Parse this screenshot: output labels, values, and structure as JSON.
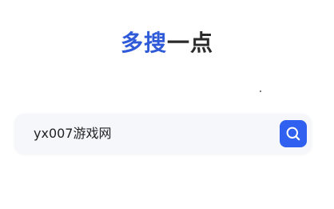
{
  "brand": {
    "part1": "多搜",
    "part2": "一点",
    "part1_color": "#2f5ad8",
    "part2_color": "#2a2a2a"
  },
  "search": {
    "value": "yx007游戏网",
    "button_icon": "search-icon",
    "button_color": "#3060ef"
  }
}
